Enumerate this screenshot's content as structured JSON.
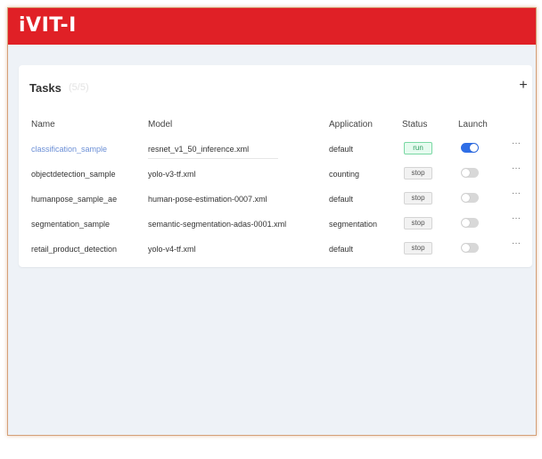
{
  "app": {
    "brand": "iVIT-I"
  },
  "tasks": {
    "title": "Tasks",
    "count": "(5/5)",
    "add_label": "+",
    "columns": {
      "name": "Name",
      "model": "Model",
      "application": "Application",
      "status": "Status",
      "launch": "Launch"
    },
    "rows": [
      {
        "name": "classification_sample",
        "model": "resnet_v1_50_inference.xml",
        "application": "default",
        "status": "run",
        "launch": "on"
      },
      {
        "name": "objectdetection_sample",
        "model": "yolo-v3-tf.xml",
        "application": "counting",
        "status": "stop",
        "launch": "off"
      },
      {
        "name": "humanpose_sample_ae",
        "model": "human-pose-estimation-0007.xml",
        "application": "default",
        "status": "stop",
        "launch": "off"
      },
      {
        "name": "segmentation_sample",
        "model": "semantic-segmentation-adas-0001.xml",
        "application": "segmentation",
        "status": "stop",
        "launch": "off"
      },
      {
        "name": "retail_product_detection",
        "model": "yolo-v4-tf.xml",
        "application": "default",
        "status": "stop",
        "launch": "off"
      }
    ],
    "more_label": "···"
  },
  "colors": {
    "brand": "#e02026",
    "link": "#6b8fd6",
    "run": "#7ad8a4",
    "toggle_on": "#2f6ee6"
  }
}
